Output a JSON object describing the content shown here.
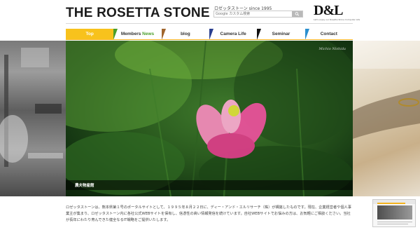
{
  "header": {
    "title": "THE ROSETTA STONE",
    "tagline": "ロゼッタストーン since 1995",
    "search_placeholder": "Google カスタム検索",
    "brand_logo_text": "D&L",
    "brand_sub": "Let's enjoy our Rosetta Stone Computer Life"
  },
  "nav": {
    "items": [
      {
        "label": "Top",
        "active": true,
        "color": "#f8c21c"
      },
      {
        "label_a": "Members",
        "label_b": "News",
        "color": "#4a9e2a"
      },
      {
        "label": "blog",
        "color": "#a0662d"
      },
      {
        "label": "Camera Life",
        "color": "#2a3f8f"
      },
      {
        "label": "Seminar",
        "color": "#111111"
      },
      {
        "label": "Contact",
        "color": "#2a8fcf"
      }
    ]
  },
  "hero": {
    "photo_credit": "Michio Nishida",
    "caption": "農夫物産館",
    "accent_color": "#e8529a"
  },
  "description": {
    "text": "ロゼッタストーンは、熊本県第１号のポータルサイトとして、１９９５年８月２２日に、ディー・アンド・エルリサーチ（株）が構築したものです。現在、企業経営者や個人事業主が集まり、ロゼッタストーン内に各社公式WEBサイトを保有し、信憑性の高い情報発信を続けています。自社WEBサイトでお悩みの方は、お気軽にご相談ください。当社が長年にわたり育んできた健全なるIT戦略をご提供いたします。"
  }
}
